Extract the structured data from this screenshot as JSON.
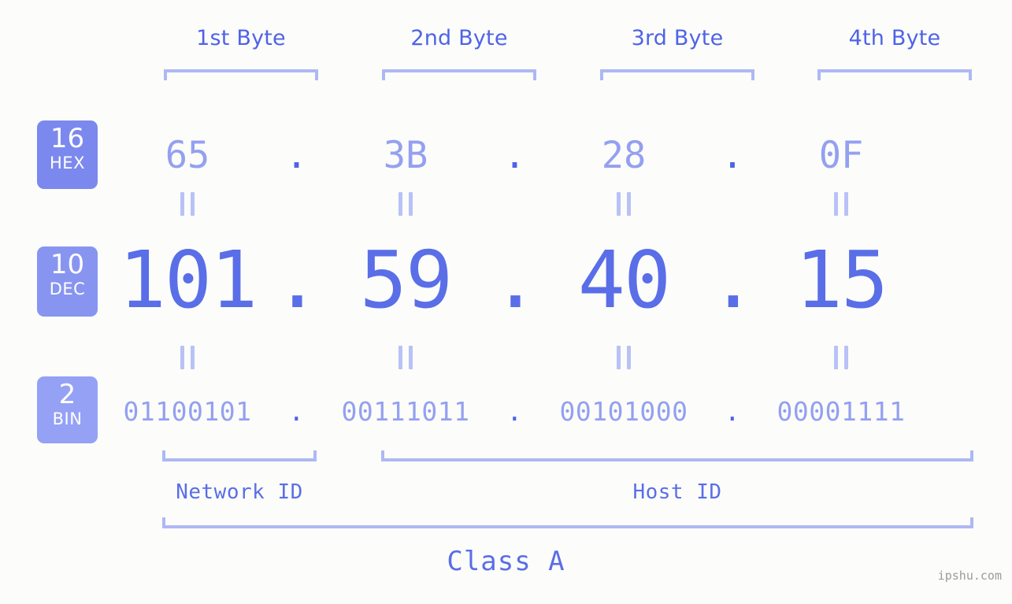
{
  "meta": {
    "background_color": "#fcfdfa",
    "accent_strong": "#4f63e8",
    "accent_mid": "#5a6ee8",
    "accent_light": "#94a0f0",
    "bracket_color": "#aeb8f5",
    "watermark_color": "#9a9a9a"
  },
  "watermark": "ipshu.com",
  "headers": [
    {
      "label": "1st Byte"
    },
    {
      "label": "2nd Byte"
    },
    {
      "label": "3rd Byte"
    },
    {
      "label": "4th Byte"
    }
  ],
  "badges": [
    {
      "number": "16",
      "unit": "HEX",
      "color": "#7b89ee"
    },
    {
      "number": "10",
      "unit": "DEC",
      "color": "#8895f0"
    },
    {
      "number": "2",
      "unit": "BIN",
      "color": "#95a1f4"
    }
  ],
  "separator": ".",
  "rows": {
    "hex": {
      "base": "16",
      "name": "HEX",
      "values": [
        "65",
        "3B",
        "28",
        "0F"
      ],
      "joined": "65.3B.28.0F"
    },
    "dec": {
      "base": "10",
      "name": "DEC",
      "values": [
        "101",
        "59",
        "40",
        "15"
      ],
      "joined": "101.59.40.15"
    },
    "bin": {
      "base": "2",
      "name": "BIN",
      "values": [
        "01100101",
        "00111011",
        "00101000",
        "00001111"
      ],
      "joined": "01100101.00111011.00101000.00001111"
    }
  },
  "equality_symbol": "=",
  "id_sections": [
    {
      "label": "Network ID",
      "bytes": 1
    },
    {
      "label": "Host ID",
      "bytes": 3
    }
  ],
  "class": {
    "label": "Class A"
  }
}
